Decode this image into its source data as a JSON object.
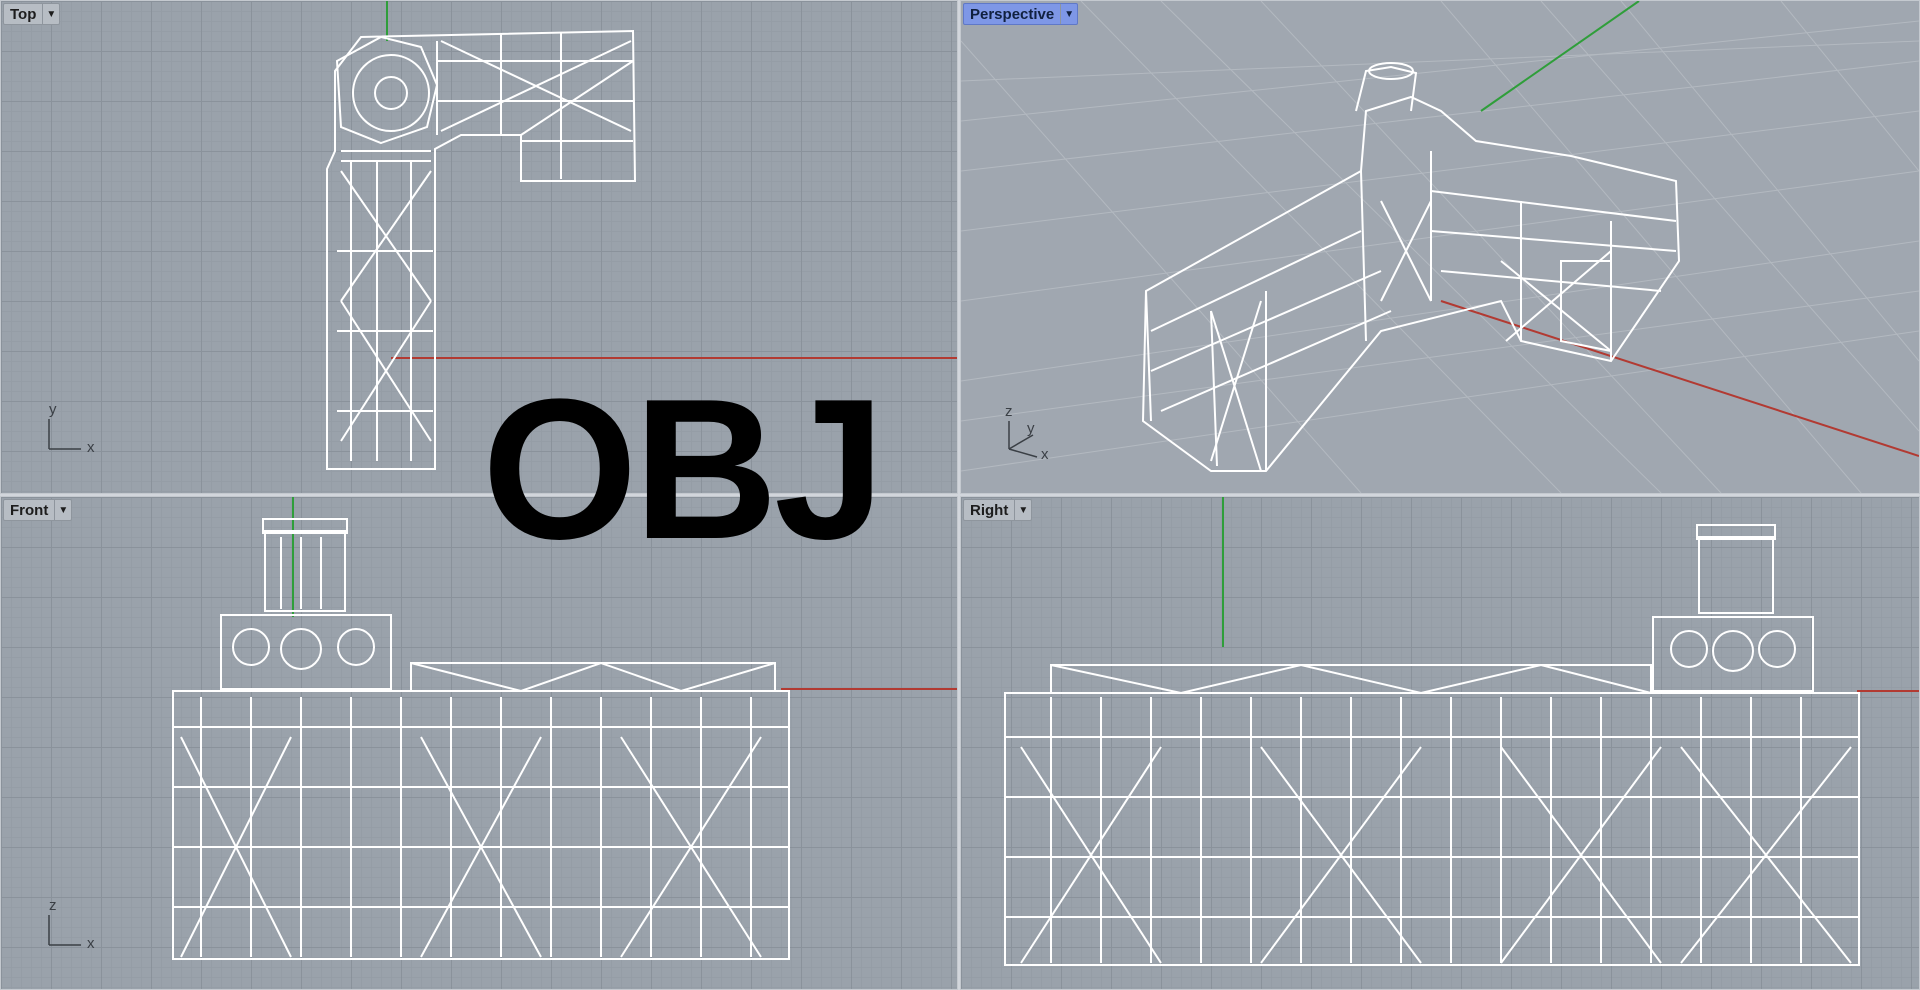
{
  "viewports": [
    {
      "id": "top",
      "label": "Top",
      "active": false,
      "axes": [
        "y",
        "x"
      ]
    },
    {
      "id": "perspective",
      "label": "Perspective",
      "active": true,
      "axes": [
        "z",
        "y",
        "x"
      ]
    },
    {
      "id": "front",
      "label": "Front",
      "active": false,
      "axes": [
        "z",
        "x"
      ]
    },
    {
      "id": "right",
      "label": "Right",
      "active": false,
      "axes": []
    }
  ],
  "overlay": {
    "text": "OBJ"
  },
  "colors": {
    "x_axis": "#b23a32",
    "y_axis": "#2f9e3a",
    "wire": "#ffffff",
    "active_label": "#7e97e6"
  },
  "icons": {
    "viewport_menu": "chevron-down-icon"
  }
}
